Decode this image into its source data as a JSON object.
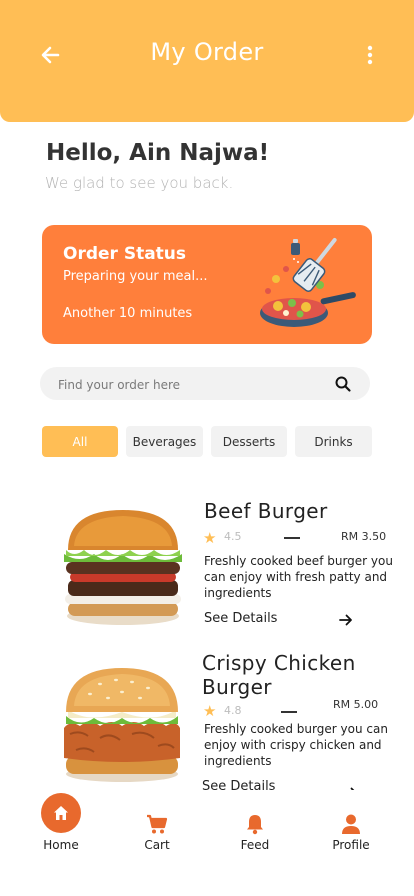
{
  "header": {
    "title": "My Order",
    "back_icon": "arrow-left-icon",
    "menu_icon": "more-vertical-icon",
    "color": "#FFBE55"
  },
  "greeting": {
    "title": "Hello, Ain Najwa!",
    "subtitle": "We glad to see you back."
  },
  "order_status": {
    "title": "Order Status",
    "message": "Preparing your meal...",
    "eta": "Another 10 minutes",
    "color": "#FF7F3B",
    "illustration": "frying-pan-spatula-illustration"
  },
  "search": {
    "placeholder": "Find your order here",
    "value": "",
    "icon": "search-icon"
  },
  "categories": [
    {
      "label": "All",
      "active": true
    },
    {
      "label": "Beverages",
      "active": false
    },
    {
      "label": "Desserts",
      "active": false
    },
    {
      "label": "Drinks",
      "active": false
    }
  ],
  "items": [
    {
      "name": "Beef Burger",
      "rating": "4.5",
      "price": "RM 3.50",
      "description": "Freshly cooked beef burger you can enjoy with fresh patty and ingredients",
      "details_label": "See Details"
    },
    {
      "name": "Crispy Chicken Burger",
      "rating": "4.8",
      "price": "RM 5.00",
      "description": "Freshly cooked burger you can enjoy with crispy chicken and ingredients",
      "details_label": "See Details"
    }
  ],
  "nav": [
    {
      "label": "Home",
      "icon": "home-icon",
      "active": true
    },
    {
      "label": "Cart",
      "icon": "cart-icon",
      "active": false
    },
    {
      "label": "Feed",
      "icon": "bell-icon",
      "active": false
    },
    {
      "label": "Profile",
      "icon": "user-icon",
      "active": false
    }
  ],
  "accent_color": "#E8692D"
}
